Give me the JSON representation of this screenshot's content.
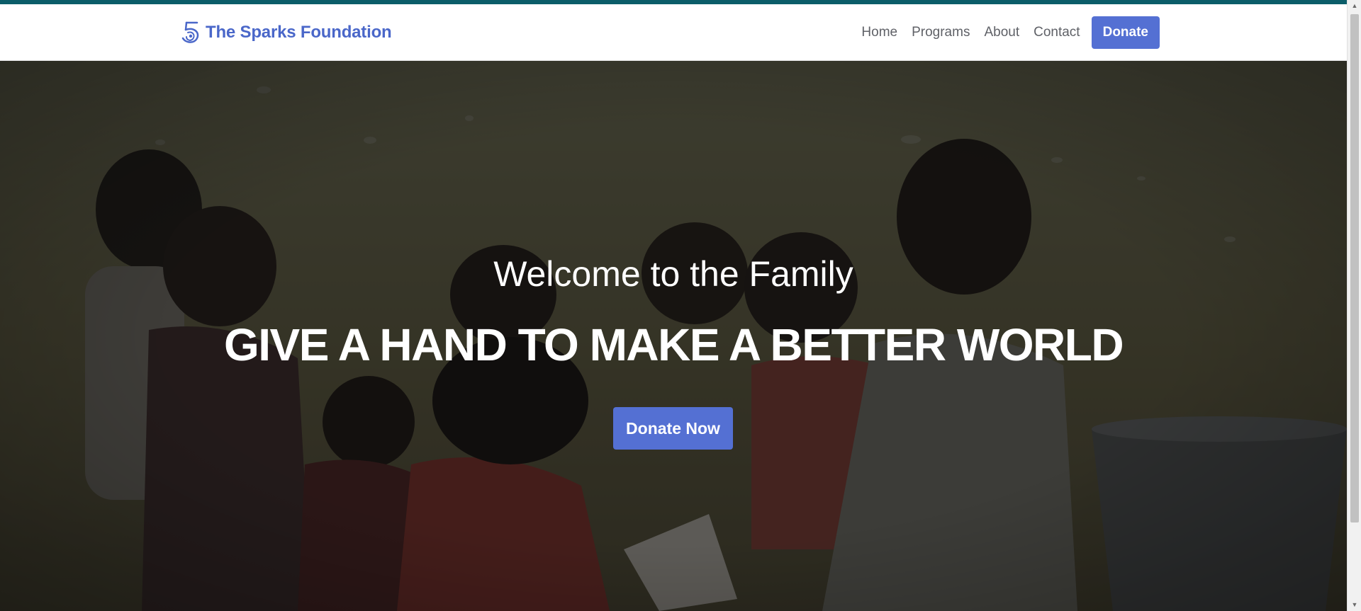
{
  "brand": {
    "name": "The Sparks Foundation",
    "icon": "sparks-logo-icon",
    "color": "#4a67c9"
  },
  "nav": {
    "items": [
      {
        "label": "Home"
      },
      {
        "label": "Programs"
      },
      {
        "label": "About"
      },
      {
        "label": "Contact"
      }
    ],
    "donate_label": "Donate"
  },
  "hero": {
    "welcome": "Welcome to the Family",
    "headline": "GIVE A HAND TO MAKE A BETTER WORLD",
    "cta_label": "Donate Now"
  },
  "colors": {
    "accent_bar": "#0b5d69",
    "primary_button": "#5470d3",
    "nav_text": "#5f6167"
  }
}
